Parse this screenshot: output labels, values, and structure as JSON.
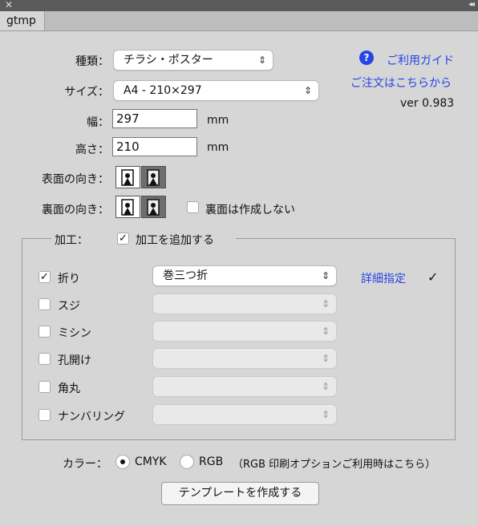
{
  "window": {
    "close_glyph": "✕",
    "collapse_glyph": "◂◂",
    "tab": "gtmp"
  },
  "form": {
    "type_label": "種類：",
    "type_value": "チラシ・ポスター",
    "size_label": "サイズ：",
    "size_value": "A4 - 210×297",
    "width_label": "幅：",
    "width_value": "297",
    "height_label": "高さ：",
    "height_value": "210",
    "unit": "mm",
    "front_label": "表面の向き：",
    "back_label": "裏面の向き：",
    "no_back_label": "裏面は作成しない"
  },
  "links": {
    "guide": "ご利用ガイド",
    "order": "ご注文はこちらから",
    "help_glyph": "?"
  },
  "version": "ver 0.983",
  "processing": {
    "label": "加工：",
    "add_label": "加工を追加する",
    "add_checked": "✓",
    "items": [
      {
        "label": "折り",
        "checked": "✓",
        "value": "巻三つ折"
      },
      {
        "label": "スジ",
        "checked": "",
        "value": ""
      },
      {
        "label": "ミシン",
        "checked": "",
        "value": ""
      },
      {
        "label": "孔開け",
        "checked": "",
        "value": ""
      },
      {
        "label": "角丸",
        "checked": "",
        "value": ""
      },
      {
        "label": "ナンバリング",
        "checked": "",
        "value": ""
      }
    ],
    "detail_link": "詳細指定",
    "detail_check": "✓"
  },
  "color": {
    "label": "カラー：",
    "cmyk": "CMYK",
    "rgb": "RGB",
    "note": "（RGB 印刷オプションご利用時はこちら）"
  },
  "create_button": "テンプレートを作成する",
  "colors": {
    "link": "#2545e6",
    "panel": "#d6d6d6"
  }
}
